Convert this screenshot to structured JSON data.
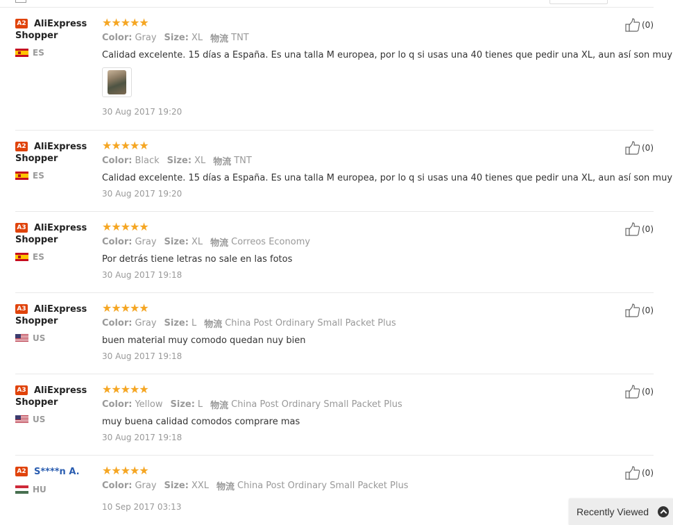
{
  "reviews": [
    {
      "level": "A2",
      "name_line1": "AliExpress",
      "name_line2": "Shopper",
      "country_code": "ES",
      "flag": "flag-es",
      "attrs": [
        {
          "key": "Color:",
          "value": "Gray"
        },
        {
          "key": "Size:",
          "value": "XL"
        },
        {
          "key": "物流",
          "value": "TNT"
        }
      ],
      "text": "Calidad excelente. 15 días a España. Es una talla M europea, por lo q si usas una 40 tienes que pedir una XL, aun así son muy justos.",
      "has_photo": true,
      "date": "30 Aug 2017 19:20",
      "helpful_count": "(0)"
    },
    {
      "level": "A2",
      "name_line1": "AliExpress",
      "name_line2": "Shopper",
      "country_code": "ES",
      "flag": "flag-es",
      "attrs": [
        {
          "key": "Color:",
          "value": "Black"
        },
        {
          "key": "Size:",
          "value": "XL"
        },
        {
          "key": "物流",
          "value": "TNT"
        }
      ],
      "text": "Calidad excelente. 15 días a España. Es una talla M europea, por lo q si usas una 40 tienes que pedir una XL, aun así son muy justos.",
      "date": "30 Aug 2017 19:20",
      "helpful_count": "(0)"
    },
    {
      "level": "A3",
      "name_line1": "AliExpress",
      "name_line2": "Shopper",
      "country_code": "ES",
      "flag": "flag-es",
      "attrs": [
        {
          "key": "Color:",
          "value": "Gray"
        },
        {
          "key": "Size:",
          "value": "XL"
        },
        {
          "key": "物流",
          "value": "Correos Economy"
        }
      ],
      "text": "Por detrás tiene letras no sale en las fotos",
      "date": "30 Aug 2017 19:18",
      "helpful_count": "(0)"
    },
    {
      "level": "A3",
      "name_line1": "AliExpress",
      "name_line2": "Shopper",
      "country_code": "US",
      "flag": "flag-us",
      "attrs": [
        {
          "key": "Color:",
          "value": "Gray"
        },
        {
          "key": "Size:",
          "value": "L"
        },
        {
          "key": "物流",
          "value": "China Post Ordinary Small Packet Plus"
        }
      ],
      "text": "buen material muy comodo quedan nuy bien",
      "date": "30 Aug 2017 19:18",
      "helpful_count": "(0)"
    },
    {
      "level": "A3",
      "name_line1": "AliExpress",
      "name_line2": "Shopper",
      "country_code": "US",
      "flag": "flag-us",
      "attrs": [
        {
          "key": "Color:",
          "value": "Yellow"
        },
        {
          "key": "Size:",
          "value": "L"
        },
        {
          "key": "物流",
          "value": "China Post Ordinary Small Packet Plus"
        }
      ],
      "text": "muy buena calidad comodos comprare mas",
      "date": "30 Aug 2017 19:18",
      "helpful_count": "(0)"
    },
    {
      "level": "A2",
      "name_line1": "S****n A.",
      "name_line2": "",
      "name_is_link": true,
      "country_code": "HU",
      "flag": "flag-hu",
      "attrs": [
        {
          "key": "Color:",
          "value": "Gray"
        },
        {
          "key": "Size:",
          "value": "XXL"
        },
        {
          "key": "物流",
          "value": "China Post Ordinary Small Packet Plus"
        }
      ],
      "text": "",
      "date": "10 Sep 2017 03:13",
      "helpful_count": "(0)"
    }
  ],
  "star_glyph": "★",
  "recently_viewed": {
    "label": "Recently Viewed",
    "icon": "chevron-up-circle-icon"
  },
  "colors": {
    "badge": "#e0430b",
    "star": "#f5a623",
    "link_name": "#2a5db0"
  }
}
